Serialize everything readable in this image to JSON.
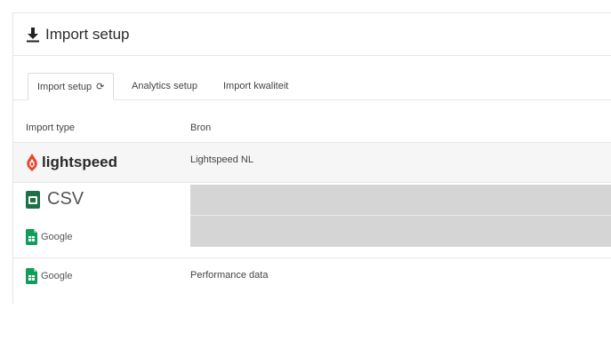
{
  "header": {
    "title": "Import setup",
    "icon": "download-icon"
  },
  "tabs": [
    {
      "label": "Import setup",
      "active": true,
      "icon": "sync-icon",
      "icon_glyph": "⟳"
    },
    {
      "label": "Analytics setup",
      "active": false
    },
    {
      "label": "Import kwaliteit",
      "active": false
    }
  ],
  "table": {
    "columns": [
      "Import type",
      "Bron"
    ],
    "rows": [
      {
        "type_logo": "lightspeed",
        "type_text": "lightspeed",
        "source": "Lightspeed NL"
      },
      {
        "type_logo": "csv",
        "type_text": "CSV",
        "source": ""
      },
      {
        "type_logo": "google-sheets",
        "type_text": "Google",
        "source": ""
      },
      {
        "type_logo": "google-sheets",
        "type_text": "Google",
        "source": "Performance data"
      }
    ]
  },
  "colors": {
    "lightspeed_red": "#e8452c",
    "csv_green": "#1e7145",
    "sheets_green": "#0f9d58",
    "redaction_grey": "#d5d5d5"
  }
}
